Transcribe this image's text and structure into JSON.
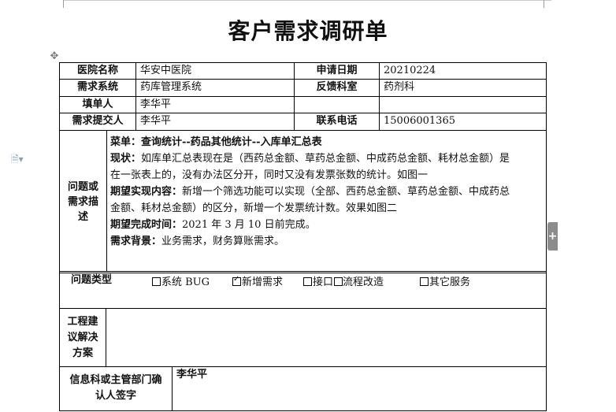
{
  "title": "客户需求调研单",
  "info": {
    "hospital_label": "医院名称",
    "hospital_value": "华安中医院",
    "date_label": "申请日期",
    "date_value": "20210224",
    "system_label": "需求系统",
    "system_value": "药库管理系统",
    "dept_label": "反馈科室",
    "dept_value": "药剂科",
    "filler_label": "填单人",
    "filler_value": "李华平",
    "submitter_label": "需求提交人",
    "submitter_value": "李华平",
    "phone_label": "联系电话",
    "phone_value": "15006001365"
  },
  "problem": {
    "label_lines": [
      "问题或",
      "需求描",
      "述"
    ],
    "menu": "菜单：查询统计--药品其他统计--入库单汇总表",
    "status_label": "现状：",
    "status_text_1": "如库单汇总表现在是（西药总金额、草药总金额、中成药总金额、耗材总金额）是",
    "status_text_2": "在一张表上的，没有办法区分开，同时又没有发票张数的统计。如图一",
    "expect_label": "期望实现内容：",
    "expect_text_1": "新增一个筛选功能可以实现（全部、西药总金额、草药总金额、中成药总",
    "expect_text_2": "金额、耗材总金额）的区分，新增一个发票统计数。效果如图二",
    "deadline_label": "期望完成时间：",
    "deadline_text": "2021 年 3 月 10 日前完成。",
    "background_label": "需求背景：",
    "background_text": "业务需求，财务算账需求。"
  },
  "type": {
    "label": "问题类型",
    "options": [
      {
        "text": "系统 BUG",
        "checked": false
      },
      {
        "text": "新增需求",
        "checked": true
      },
      {
        "text": "接口",
        "checked": false
      },
      {
        "text": "流程改造",
        "checked": false
      },
      {
        "text": "其它服务",
        "checked": false
      }
    ]
  },
  "solution": {
    "label_lines": [
      "工程建",
      "议解决",
      "方案"
    ],
    "value": ""
  },
  "signoff": {
    "label_lines": [
      "信息科或主管部门确",
      "认人签字"
    ],
    "value": "李华平"
  }
}
